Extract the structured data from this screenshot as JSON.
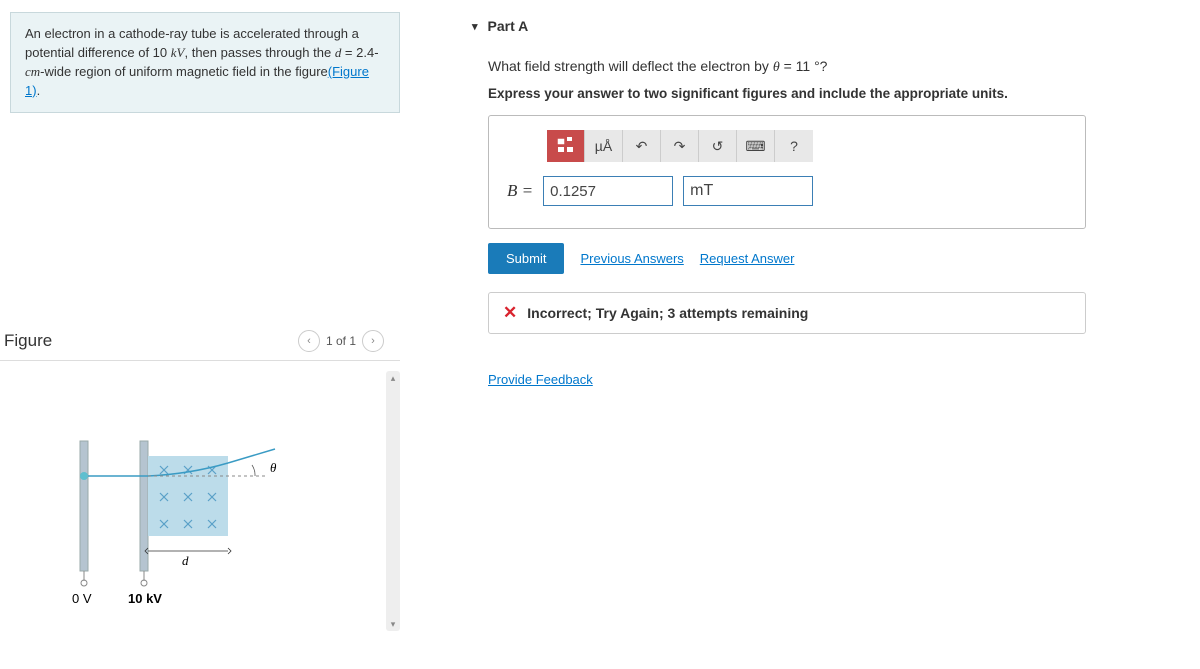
{
  "problem": {
    "text_before": "An electron in a cathode-ray tube is accelerated through a potential difference of 10 ",
    "kv": "kV",
    "text_mid": ", then passes through the ",
    "d_eq": "d",
    "text_mid2": " = 2.4-",
    "cm": "cm",
    "text_after": "-wide region of uniform magnetic field in the figure",
    "figure_link": "(Figure 1)",
    "period": "."
  },
  "figure": {
    "heading": "Figure",
    "nav": "1 of 1",
    "label_0v": "0 V",
    "label_10kv": "10 kV",
    "d_label": "d",
    "theta_label": "θ"
  },
  "part": {
    "label": "Part A",
    "question_before": "What field strength will deflect the electron by ",
    "theta": "θ",
    "question_after": " = 11 °?",
    "instruction": "Express your answer to two significant figures and include the appropriate units.",
    "toolbar": {
      "templates": "▭",
      "units": "µÅ",
      "undo": "↶",
      "redo": "↷",
      "reset": "↺",
      "keyboard": "⌨",
      "help": "?"
    },
    "answer_label": "B =",
    "answer_value": "0.1257",
    "answer_unit": "mT",
    "submit": "Submit",
    "prev_answers": "Previous Answers",
    "request_answer": "Request Answer",
    "feedback": "Incorrect; Try Again; 3 attempts remaining",
    "provide_feedback": "Provide Feedback"
  }
}
